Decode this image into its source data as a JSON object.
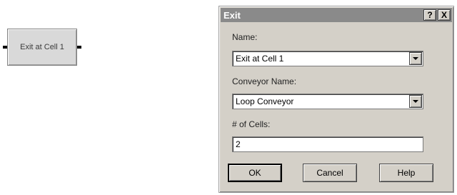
{
  "module": {
    "label": "Exit at Cell 1"
  },
  "dialog": {
    "title": "Exit",
    "help_glyph": "?",
    "close_glyph": "X",
    "name_label": "Name:",
    "name_value": "Exit at Cell 1",
    "conveyor_label": "Conveyor Name:",
    "conveyor_value": "Loop Conveyor",
    "cells_label": "# of Cells:",
    "cells_value": "2",
    "ok_label": "OK",
    "cancel_label": "Cancel",
    "help_label": "Help"
  }
}
